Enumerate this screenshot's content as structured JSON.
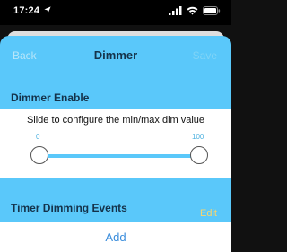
{
  "status_bar": {
    "time": "17:24",
    "location_icon": "location-arrow-icon",
    "icons": [
      "signal-bars-icon",
      "wifi-icon",
      "battery-icon"
    ]
  },
  "nav": {
    "back_label": "Back",
    "title": "Dimmer",
    "save_label": "Save"
  },
  "dimmer_enable": {
    "title": "Dimmer Enable"
  },
  "slider": {
    "caption": "Slide to configure the min/max dim value",
    "min_label": "0",
    "max_label": "100",
    "min_value": 0,
    "max_value": 100
  },
  "timer_events": {
    "title": "Timer Dimming Events",
    "edit_label": "Edit"
  },
  "add": {
    "label": "Add"
  },
  "colors": {
    "accent": "#5ac8fa",
    "title_text": "#15334a",
    "add_text": "#3a8ddc",
    "edit_text": "#f6d56f"
  }
}
